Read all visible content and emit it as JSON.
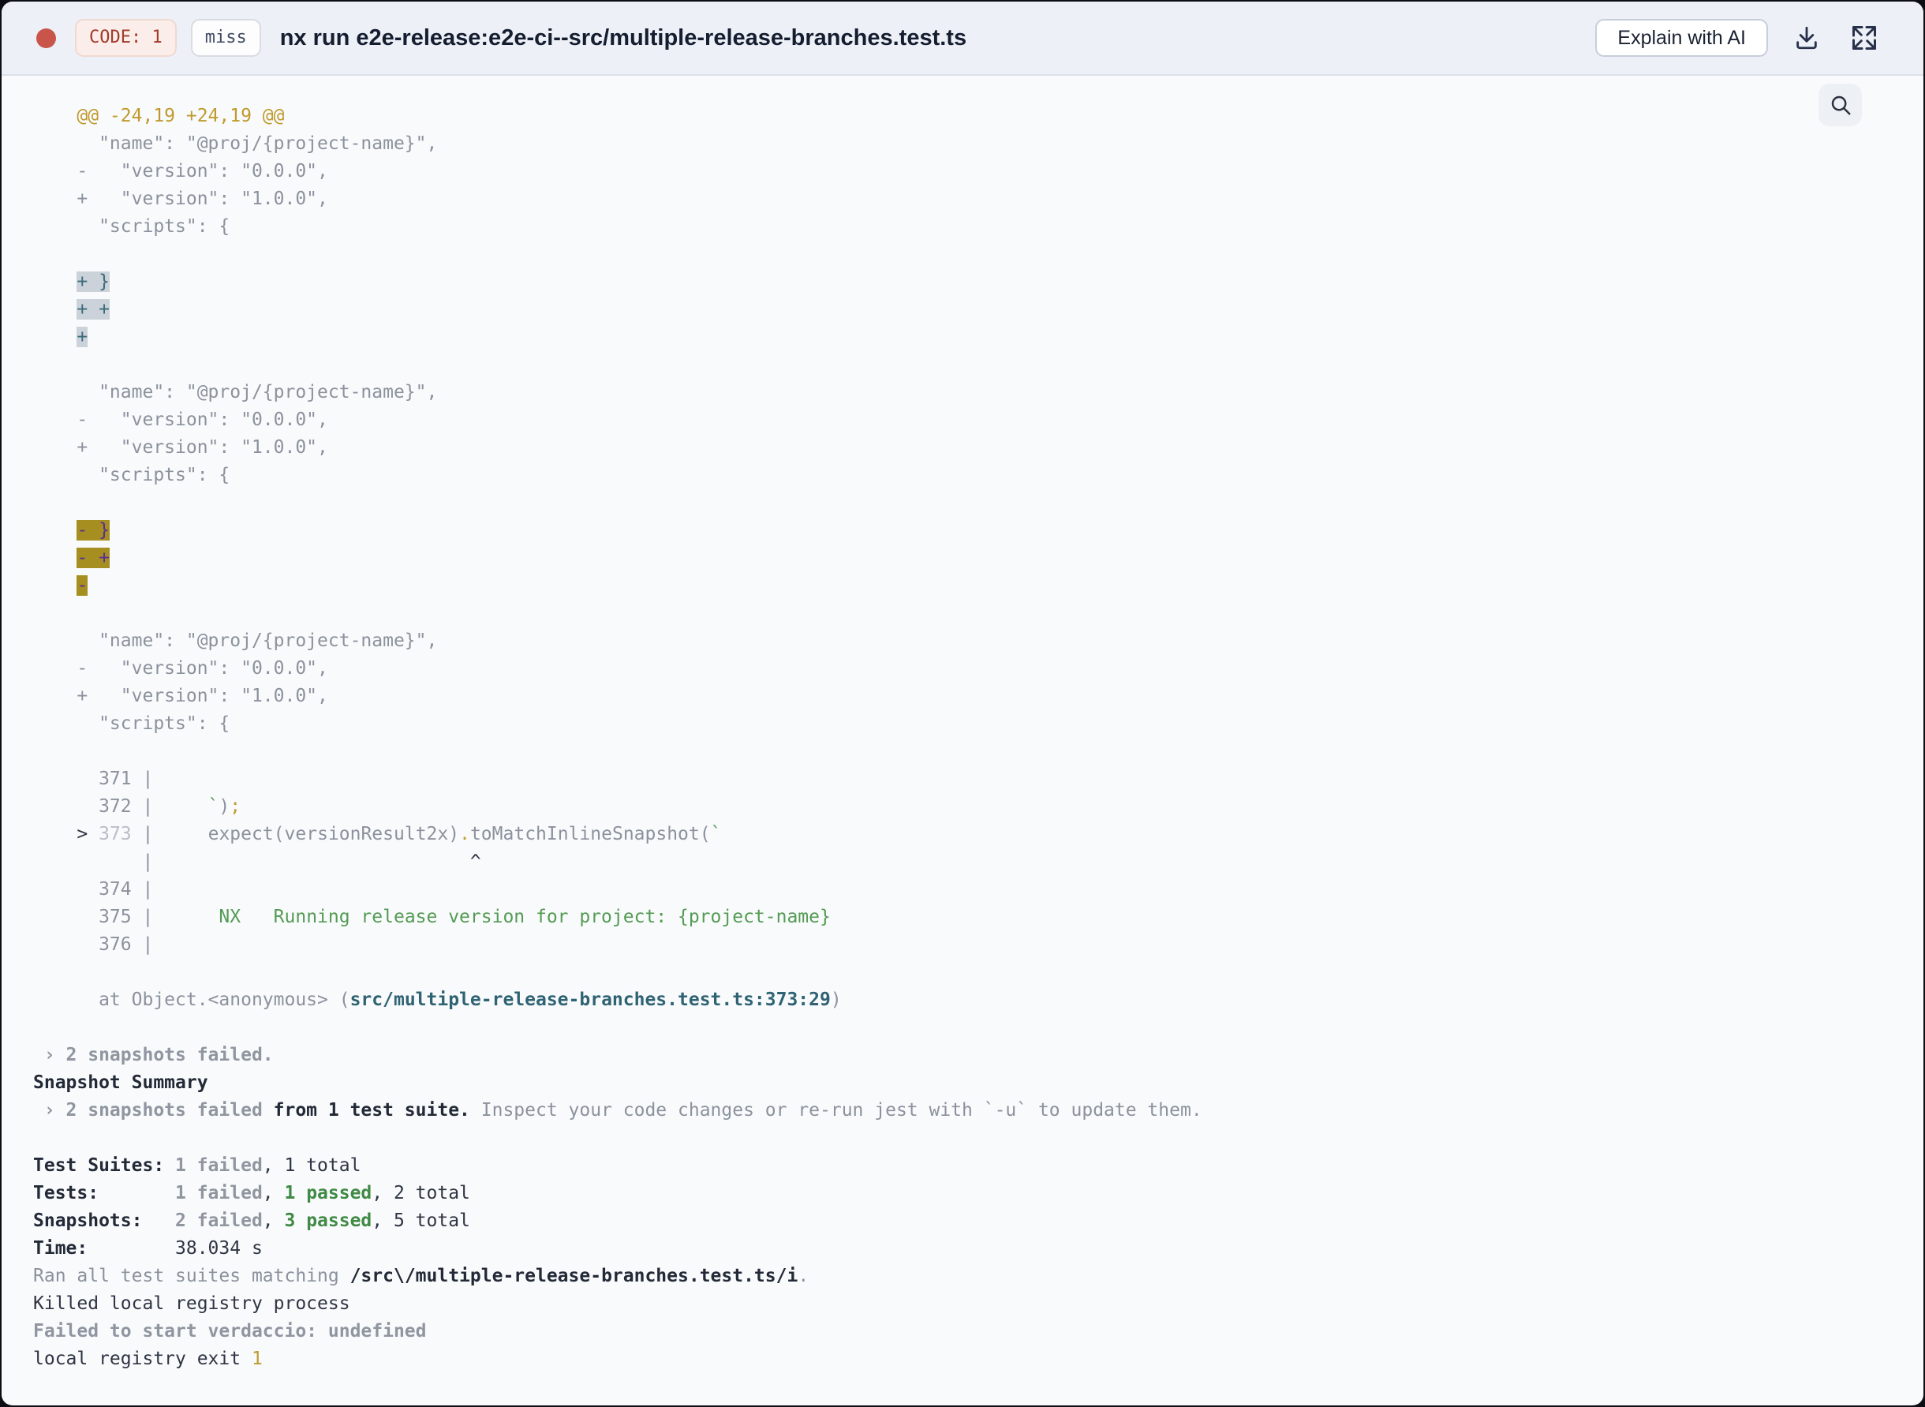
{
  "header": {
    "code_badge": "CODE: 1",
    "cache_badge": "miss",
    "title": "nx run e2e-release:e2e-ci--src/multiple-release-branches.test.ts",
    "explain_button": "Explain with AI"
  },
  "icons": {
    "status_dot": "red-status-dot",
    "download": "download-icon",
    "fullscreen": "expand-icon",
    "search": "search-icon"
  },
  "colors": {
    "status_dot": "#c9544a",
    "header_bg": "#edf0f6",
    "terminal_bg": "#f9fafc",
    "diff_yellow": "#bf9a2e",
    "diff_green": "#549b53",
    "added_highlight_bg": "#cbd2d9",
    "added_highlight_text": "#3b6b7b",
    "removed_highlight_bg": "#a68e20",
    "removed_highlight_text": "#5a2f94",
    "passed_green": "#3f8a44",
    "link_teal": "#2f6374"
  },
  "terminal": {
    "lines": [
      {
        "n": "diff-hunk-header",
        "s": [
          [
            "    @@ -24,19 +24,19 @@",
            "y"
          ]
        ]
      },
      {
        "n": "diff-context-line",
        "s": [
          [
            "      \"name\": \"@proj/{project-name}\",",
            "g"
          ]
        ]
      },
      {
        "n": "diff-removed-line",
        "s": [
          [
            "    -   \"version\": \"0.0.0\",",
            "g"
          ]
        ]
      },
      {
        "n": "diff-added-line",
        "s": [
          [
            "    +   \"version\": \"1.0.0\",",
            "g"
          ]
        ]
      },
      {
        "n": "diff-context-line",
        "s": [
          [
            "      \"scripts\": {",
            "g"
          ]
        ]
      },
      {
        "n": "blank-line",
        "s": []
      },
      {
        "n": "diff-added-highlight",
        "s": [
          [
            "    ",
            "g"
          ],
          [
            "+ }",
            "hlb"
          ]
        ]
      },
      {
        "n": "diff-added-highlight",
        "s": [
          [
            "    ",
            "g"
          ],
          [
            "+ +",
            "hlb"
          ]
        ]
      },
      {
        "n": "diff-added-highlight",
        "s": [
          [
            "    ",
            "g"
          ],
          [
            "+",
            "hlb"
          ]
        ]
      },
      {
        "n": "blank-line",
        "s": []
      },
      {
        "n": "diff-context-line",
        "s": [
          [
            "      \"name\": \"@proj/{project-name}\",",
            "g"
          ]
        ]
      },
      {
        "n": "diff-removed-line",
        "s": [
          [
            "    -   \"version\": \"0.0.0\",",
            "g"
          ]
        ]
      },
      {
        "n": "diff-added-line",
        "s": [
          [
            "    +   \"version\": \"1.0.0\",",
            "g"
          ]
        ]
      },
      {
        "n": "diff-context-line",
        "s": [
          [
            "      \"scripts\": {",
            "g"
          ]
        ]
      },
      {
        "n": "blank-line",
        "s": []
      },
      {
        "n": "diff-removed-highlight",
        "s": [
          [
            "    ",
            "g"
          ],
          [
            "- }",
            "hly"
          ]
        ]
      },
      {
        "n": "diff-removed-highlight",
        "s": [
          [
            "    ",
            "g"
          ],
          [
            "- +",
            "hly"
          ]
        ]
      },
      {
        "n": "diff-removed-highlight",
        "s": [
          [
            "    ",
            "g"
          ],
          [
            "-",
            "hly"
          ]
        ]
      },
      {
        "n": "blank-line",
        "s": []
      },
      {
        "n": "diff-context-line",
        "s": [
          [
            "      \"name\": \"@proj/{project-name}\",",
            "g"
          ]
        ]
      },
      {
        "n": "diff-removed-line",
        "s": [
          [
            "    -   \"version\": \"0.0.0\",",
            "g"
          ]
        ]
      },
      {
        "n": "diff-added-line",
        "s": [
          [
            "    +   \"version\": \"1.0.0\",",
            "g"
          ]
        ]
      },
      {
        "n": "diff-context-line",
        "s": [
          [
            "      \"scripts\": {",
            "g"
          ]
        ]
      },
      {
        "n": "blank-line",
        "s": []
      },
      {
        "n": "code-frame-line",
        "s": [
          [
            "      371 |",
            "g"
          ]
        ]
      },
      {
        "n": "code-frame-line",
        "s": [
          [
            "      372 |     ",
            "g"
          ],
          [
            "`",
            "gr"
          ],
          [
            ")",
            "g"
          ],
          [
            ";",
            "y"
          ]
        ]
      },
      {
        "n": "code-frame-error-line",
        "s": [
          [
            "    ",
            "g"
          ],
          [
            ">",
            "d"
          ],
          [
            " ",
            "g"
          ],
          [
            "373",
            "dim"
          ],
          [
            " |     ",
            "g"
          ],
          [
            "expect(versionResult2x)",
            "g"
          ],
          [
            ".",
            "y"
          ],
          [
            "toMatchInlineSnapshot(",
            "g"
          ],
          [
            "`",
            "gr"
          ]
        ]
      },
      {
        "n": "code-frame-caret-line",
        "s": [
          [
            "          |                             ",
            "g"
          ],
          [
            "^",
            "d"
          ]
        ]
      },
      {
        "n": "code-frame-line",
        "s": [
          [
            "      374 |",
            "g"
          ]
        ]
      },
      {
        "n": "code-frame-line",
        "s": [
          [
            "      375 |",
            "g"
          ],
          [
            "      NX   Running release version for project: {project-name}",
            "gr"
          ]
        ]
      },
      {
        "n": "code-frame-line",
        "s": [
          [
            "      376 |",
            "g"
          ]
        ]
      },
      {
        "n": "blank-line",
        "s": []
      },
      {
        "n": "stack-trace-line",
        "s": [
          [
            "      at Object.<anonymous> (",
            "g"
          ],
          [
            "src/multiple-release-branches.test.ts:373:29",
            "tl"
          ],
          [
            ")",
            "g"
          ]
        ]
      },
      {
        "n": "blank-line",
        "s": []
      },
      {
        "n": "snapshots-failed-line",
        "s": [
          [
            " › 2 snapshots failed.",
            "bg"
          ]
        ]
      },
      {
        "n": "snapshot-summary-heading",
        "s": [
          [
            "Snapshot Summary",
            "bd"
          ]
        ]
      },
      {
        "n": "snapshot-summary-line",
        "s": [
          [
            " › 2 snapshots failed",
            "bg"
          ],
          [
            " from 1 test suite. ",
            "bd"
          ],
          [
            "Inspect your code changes or re-run jest with `-u` to update them.",
            "g"
          ]
        ]
      },
      {
        "n": "blank-line",
        "s": []
      },
      {
        "n": "test-suites-summary",
        "s": [
          [
            "Test Suites: ",
            "bd"
          ],
          [
            "1 failed",
            "bg"
          ],
          [
            ", 1 total",
            "d"
          ]
        ]
      },
      {
        "n": "tests-summary",
        "s": [
          [
            "Tests:       ",
            "bd"
          ],
          [
            "1 failed",
            "bg"
          ],
          [
            ", ",
            "d"
          ],
          [
            "1 passed",
            "bgr"
          ],
          [
            ", 2 total",
            "d"
          ]
        ]
      },
      {
        "n": "snapshots-summary",
        "s": [
          [
            "Snapshots:   ",
            "bd"
          ],
          [
            "2 failed",
            "bg"
          ],
          [
            ", ",
            "d"
          ],
          [
            "3 passed",
            "bgr"
          ],
          [
            ", 5 total",
            "d"
          ]
        ]
      },
      {
        "n": "time-summary",
        "s": [
          [
            "Time:        ",
            "bd"
          ],
          [
            "38.034 s",
            "d"
          ]
        ]
      },
      {
        "n": "ran-suites-line",
        "s": [
          [
            "Ran all test suites matching ",
            "g"
          ],
          [
            "/src\\/multiple-release-branches.test.ts/i",
            "bd"
          ],
          [
            ".",
            "g"
          ]
        ]
      },
      {
        "n": "killed-registry-line",
        "s": [
          [
            "Killed local registry process",
            "d"
          ]
        ]
      },
      {
        "n": "verdaccio-line",
        "s": [
          [
            "Failed to start verdaccio: undefined",
            "bg"
          ]
        ]
      },
      {
        "n": "exit-code-line",
        "s": [
          [
            "local registry exit ",
            "d"
          ],
          [
            "1",
            "y"
          ]
        ]
      }
    ]
  }
}
